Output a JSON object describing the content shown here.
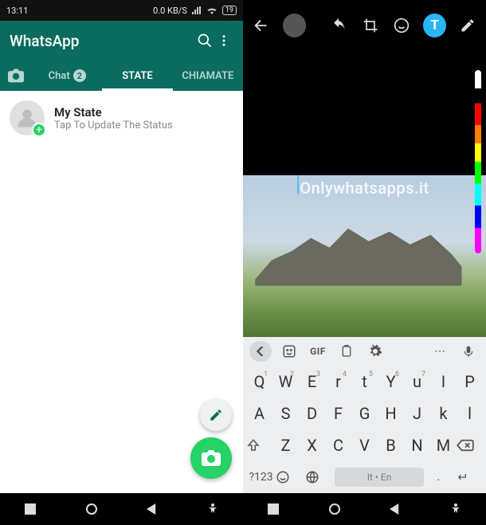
{
  "left": {
    "status": {
      "time": "13:11",
      "net": "0.0 KB/S",
      "battery": "19"
    },
    "app": {
      "title": "WhatsApp"
    },
    "tabs": {
      "chat": "Chat",
      "chat_badge": "2",
      "state": "STATE",
      "calls": "CHIAMATE"
    },
    "my_status": {
      "title": "My State",
      "subtitle": "Tap To Update The Status"
    }
  },
  "right": {
    "text_badge": "T",
    "watermark": "Onlywhatsapps.it",
    "keyboard": {
      "tools": {
        "gif": "GIF"
      },
      "row1": [
        {
          "k": "Q",
          "n": "1"
        },
        {
          "k": "W",
          "n": "2"
        },
        {
          "k": "E",
          "n": "3"
        },
        {
          "k": "r",
          "n": "4"
        },
        {
          "k": "t",
          "n": "5"
        },
        {
          "k": "Y",
          "n": "6"
        },
        {
          "k": "u",
          "n": "7"
        },
        {
          "k": "I",
          "n": ""
        },
        {
          "k": "P",
          "n": ""
        }
      ],
      "row2": [
        "A",
        "S",
        "D",
        "F",
        "G",
        "H",
        "J",
        "k",
        "l"
      ],
      "row3": [
        "Z",
        "X",
        "C",
        "V",
        "B",
        "N",
        "M"
      ],
      "row4": {
        "sym": "?123",
        "space": "It • En",
        "dot": "."
      }
    }
  }
}
